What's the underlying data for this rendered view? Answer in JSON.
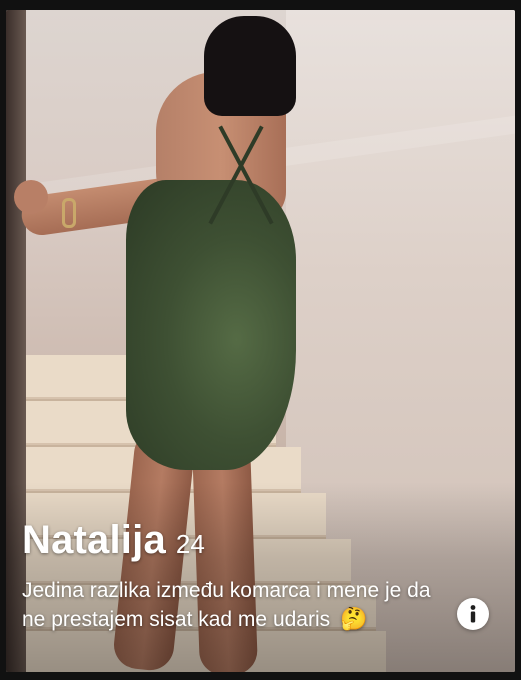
{
  "profile": {
    "name": "Natalija",
    "age": "24",
    "bio": "Jedina razlika između komarca i mene je da ne prestajem sisat kad me udaris",
    "bio_emoji": "🤔"
  },
  "info_button": {
    "icon": "info-icon",
    "glyph": "i"
  },
  "colors": {
    "dress": "#3e5033",
    "text": "#ffffff",
    "info_button_bg": "#ffffff"
  }
}
